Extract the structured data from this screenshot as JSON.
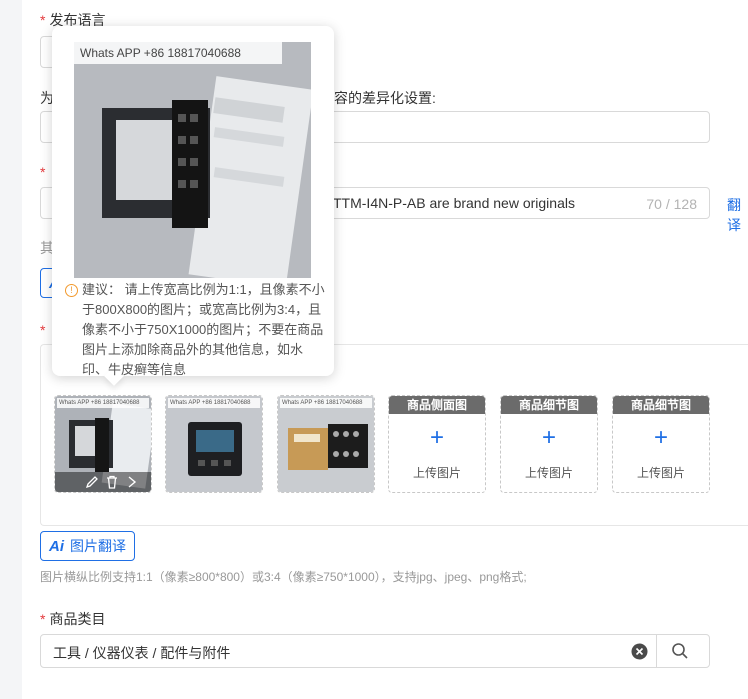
{
  "form": {
    "publish_language_label": "发布语言",
    "diff_settings_prefix": "为",
    "diff_settings_suffix": "容的差异化设置:",
    "title_input_value": "TTM-I4N-P-AB are brand new originals",
    "title_count": "70 / 128",
    "translate_link": "翻译",
    "other_prefix": "其",
    "ai_image_translate_label": "图片翻译",
    "ai_badge": "Ai",
    "image_hint": "图片横纵比例支持1:1（像素≥800*800）或3:4（像素≥750*1000），支持jpg、jpeg、png格式;",
    "category_label": "商品类目",
    "category_value": "工具 / 仪器仪表 / 配件与附件"
  },
  "images": {
    "uploaded": [
      {
        "watermark": "Whats APP +86 18817040688"
      },
      {
        "watermark": "Whats APP +86 18817040688"
      },
      {
        "watermark": "Whats APP +86 18817040688"
      }
    ],
    "slots": [
      {
        "title": "商品侧面图",
        "upload_label": "上传图片"
      },
      {
        "title": "商品细节图",
        "upload_label": "上传图片"
      },
      {
        "title": "商品细节图",
        "upload_label": "上传图片"
      }
    ]
  },
  "popover": {
    "watermark": "Whats APP +86 18817040688",
    "tip": "建议： 请上传宽高比例为1:1，且像素不小于800X800的图片；或宽高比例为3:4，且像素不小于750X1000的图片；不要在商品图片上添加除商品外的其他信息，如水印、牛皮癣等信息"
  },
  "colors": {
    "accent": "#1f6fe5",
    "required": "#e4393c",
    "warning": "#f29a2e"
  },
  "icons": [
    "edit-icon",
    "delete-icon",
    "plus-icon",
    "clear-icon",
    "search-icon",
    "warning-icon"
  ]
}
